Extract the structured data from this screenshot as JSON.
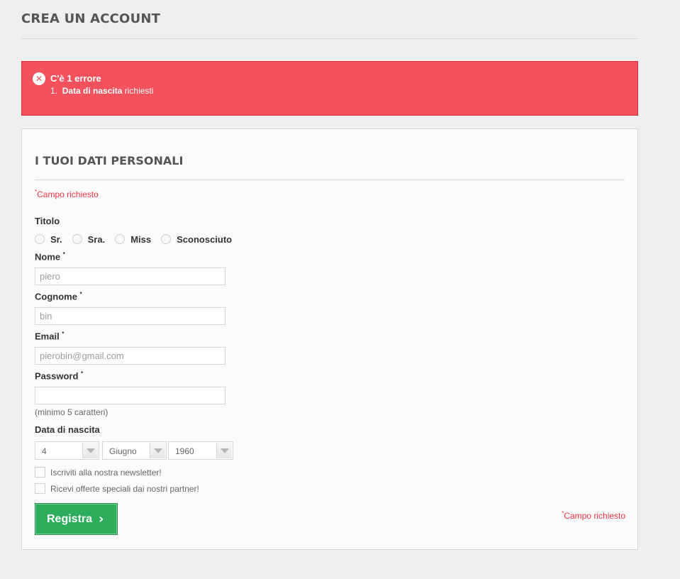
{
  "page": {
    "title": "CREA UN ACCOUNT"
  },
  "error": {
    "icon": "close-circle-icon",
    "heading": "C'è 1 errore",
    "items": [
      {
        "index": "1.",
        "field": "Data di nascita",
        "message": "richiesti"
      }
    ],
    "color": "#f3515c"
  },
  "form": {
    "section_title": "I TUOI DATI PERSONALI",
    "required_note": "Campo richiesto",
    "required_mark": "*",
    "title_label": "Titolo",
    "title_options": [
      "Sr.",
      "Sra.",
      "Miss",
      "Sconosciuto"
    ],
    "first_name": {
      "label": "Nome",
      "value": "piero"
    },
    "last_name": {
      "label": "Cognome",
      "value": "bin"
    },
    "email": {
      "label": "Email",
      "value": "pierobin@gmail.com"
    },
    "password": {
      "label": "Password",
      "value": "",
      "hint": "(minimo 5 caratteri)"
    },
    "birthdate": {
      "label": "Data di nascita",
      "day": "4",
      "month": "Giugno",
      "year": "1960"
    },
    "newsletter_label": "Iscriviti alla nostra newsletter!",
    "offers_label": "Ricevi offerte speciali dai nostri partner!",
    "submit_label": "Registra",
    "submit_icon": "chevron-right-icon",
    "submit_color": "#2bad5b"
  }
}
